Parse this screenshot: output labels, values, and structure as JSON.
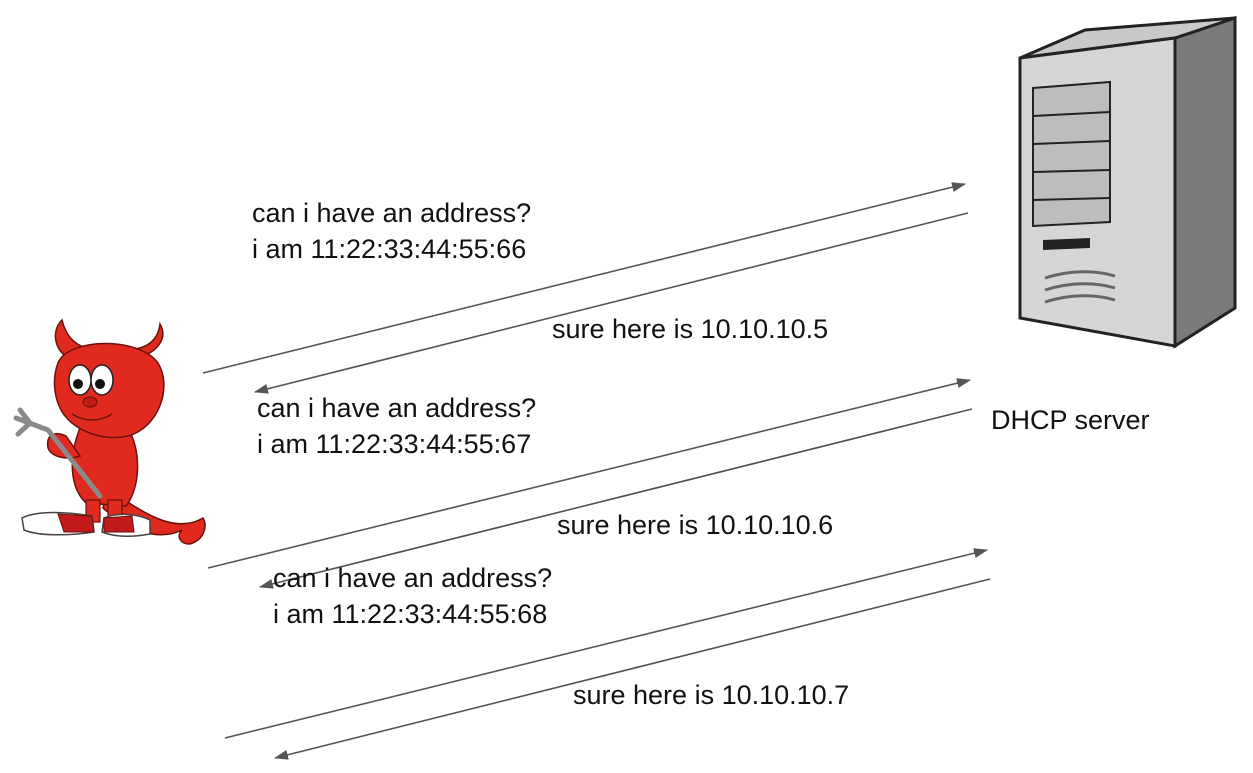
{
  "server": {
    "label": "DHCP server",
    "icon": "server-tower-icon"
  },
  "client": {
    "icon": "bsd-daemon-mascot-icon"
  },
  "colors": {
    "arrow": "#555555",
    "daemon_red": "#e02a1f",
    "server_light": "#d6d6d6",
    "server_dark": "#7a7a7a"
  },
  "exchanges": [
    {
      "request_line1": "can i have an address?",
      "request_line2": "i am 11:22:33:44:55:66",
      "reply": "sure here is 10.10.10.5"
    },
    {
      "request_line1": "can i have an address?",
      "request_line2": "i am 11:22:33:44:55:67",
      "reply": "sure here is 10.10.10.6"
    },
    {
      "request_line1": "can i have an address?",
      "request_line2": "i am 11:22:33:44:55:68",
      "reply": "sure here is 10.10.10.7"
    }
  ]
}
